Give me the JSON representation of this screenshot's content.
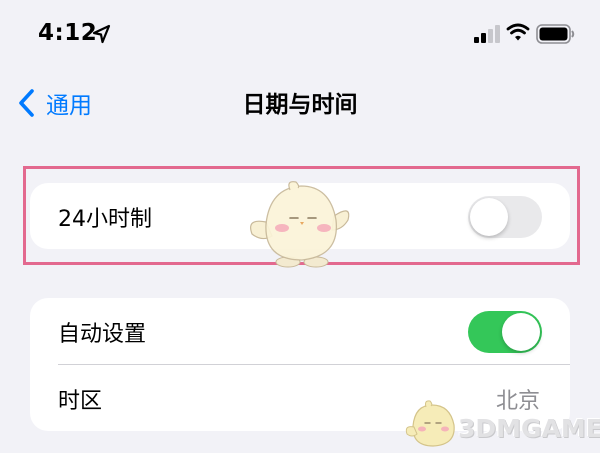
{
  "status_bar": {
    "time": "4:12"
  },
  "nav": {
    "back_label": "通用",
    "title": "日期与时间"
  },
  "group1": {
    "row_24h": {
      "label": "24小时制",
      "toggle_state": "off"
    }
  },
  "group2": {
    "row_auto": {
      "label": "自动设置",
      "toggle_state": "on"
    },
    "row_timezone": {
      "label": "时区",
      "value": "北京"
    }
  },
  "watermark": {
    "text": "3DMGAME"
  },
  "colors": {
    "background": "#f2f2f7",
    "accent_blue": "#007aff",
    "toggle_on_green": "#34c759",
    "toggle_off_gray": "#e9e9eb",
    "highlight_pink": "#e3698f",
    "secondary_text": "#8e8e93"
  },
  "icons": {
    "location": "location-arrow-icon",
    "signal": "cellular-signal-icon",
    "wifi": "wifi-icon",
    "battery": "battery-icon",
    "back": "chevron-left-icon"
  }
}
